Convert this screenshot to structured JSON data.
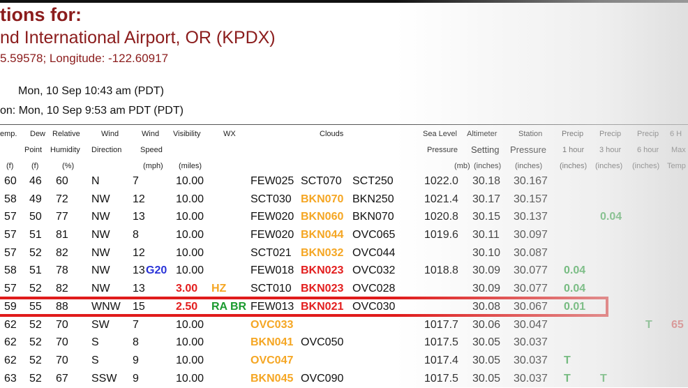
{
  "page": {
    "title": "tions for:",
    "subtitle": "nd International Airport, OR (KPDX)",
    "coords": "5.59578; Longitude: -122.60917",
    "obs_time": "Mon, 10 Sep 10:43 am (PDT)",
    "obs_time2": "on: Mon, 10 Sep 9:53 am PDT (PDT)"
  },
  "headers": {
    "temp": "emp.",
    "dew1": "Dew",
    "dew2": "Point",
    "rel1": "Relative",
    "rel2": "Humidity",
    "wind1": "Wind",
    "wind2": "Direction",
    "wspd1": "Wind",
    "wspd2": "Speed",
    "vis": "Visibility",
    "wx": "WX",
    "clouds": "Clouds",
    "slp1": "Sea Level",
    "slp2": "Pressure",
    "alt1": "Altimeter",
    "alt2": "Setting",
    "stn1": "Station",
    "stn2": "Pressure",
    "p1a": "Precip",
    "p1b": "1 hour",
    "p3a": "Precip",
    "p3b": "3 hour",
    "p6a": "Precip",
    "p6b": "6 hour",
    "max1": "6 H",
    "max2": "Max",
    "u_f1": "(f)",
    "u_f2": "(f)",
    "u_pct": "(%)",
    "u_mph": "(mph)",
    "u_miles": "(miles)",
    "u_mb": "(mb)",
    "u_in1": "(inches)",
    "u_in2": "(inches)",
    "u_in3": "(inches)",
    "u_in4": "(inches)",
    "u_in5": "(inches)",
    "u_temp": "Temp"
  },
  "rows": [
    {
      "t": "60",
      "d": "46",
      "h": "60",
      "dir": "N",
      "spd": "7",
      "gust": "",
      "vis": "10.00",
      "wx": "",
      "c1": "FEW025",
      "c2": "SCT070",
      "c3": "SCT250",
      "slp": "1022.0",
      "alt": "30.18",
      "stn": "30.167",
      "p1": "",
      "p3": "",
      "p6": "",
      "mx": ""
    },
    {
      "t": "58",
      "d": "49",
      "h": "72",
      "dir": "NW",
      "spd": "12",
      "gust": "",
      "vis": "10.00",
      "wx": "",
      "c1": "SCT030",
      "c2": "BKN070",
      "c3": "BKN250",
      "slp": "1021.4",
      "alt": "30.17",
      "stn": "30.157",
      "p1": "",
      "p3": "",
      "p6": "",
      "mx": ""
    },
    {
      "t": "57",
      "d": "50",
      "h": "77",
      "dir": "NW",
      "spd": "13",
      "gust": "",
      "vis": "10.00",
      "wx": "",
      "c1": "FEW020",
      "c2": "BKN060",
      "c3": "BKN070",
      "slp": "1020.8",
      "alt": "30.15",
      "stn": "30.137",
      "p1": "",
      "p3": "0.04",
      "p6": "",
      "mx": ""
    },
    {
      "t": "57",
      "d": "51",
      "h": "81",
      "dir": "NW",
      "spd": "8",
      "gust": "",
      "vis": "10.00",
      "wx": "",
      "c1": "FEW020",
      "c2": "BKN044",
      "c3": "OVC065",
      "slp": "1019.6",
      "alt": "30.11",
      "stn": "30.097",
      "p1": "",
      "p3": "",
      "p6": "",
      "mx": ""
    },
    {
      "t": "57",
      "d": "52",
      "h": "82",
      "dir": "NW",
      "spd": "12",
      "gust": "",
      "vis": "10.00",
      "wx": "",
      "c1": "SCT021",
      "c2": "BKN032",
      "c3": "OVC044",
      "slp": "",
      "alt": "30.10",
      "stn": "30.087",
      "p1": "",
      "p3": "",
      "p6": "",
      "mx": ""
    },
    {
      "t": "58",
      "d": "51",
      "h": "78",
      "dir": "NW",
      "spd": "13",
      "gust": "G20",
      "vis": "10.00",
      "wx": "",
      "c1": "FEW018",
      "c2": "BKN023",
      "c3": "OVC032",
      "slp": "1018.8",
      "alt": "30.09",
      "stn": "30.077",
      "p1": "0.04",
      "p3": "",
      "p6": "",
      "mx": ""
    },
    {
      "t": "57",
      "d": "52",
      "h": "82",
      "dir": "NW",
      "spd": "13",
      "gust": "",
      "vis": "3.00",
      "wx": "HZ",
      "c1": "SCT010",
      "c2": "BKN023",
      "c3": "OVC028",
      "slp": "",
      "alt": "30.09",
      "stn": "30.077",
      "p1": "0.04",
      "p3": "",
      "p6": "",
      "mx": ""
    },
    {
      "t": "59",
      "d": "55",
      "h": "88",
      "dir": "WNW",
      "spd": "15",
      "gust": "",
      "vis": "2.50",
      "wx": "RA BR",
      "c1": "FEW013",
      "c2": "BKN021",
      "c3": "OVC030",
      "slp": "",
      "alt": "30.08",
      "stn": "30.067",
      "p1": "0.01",
      "p3": "",
      "p6": "",
      "mx": ""
    },
    {
      "t": "62",
      "d": "52",
      "h": "70",
      "dir": "SW",
      "spd": "7",
      "gust": "",
      "vis": "10.00",
      "wx": "",
      "c1": "OVC033",
      "c2": "",
      "c3": "",
      "slp": "1017.7",
      "alt": "30.06",
      "stn": "30.047",
      "p1": "",
      "p3": "",
      "p6": "T",
      "mx": "65"
    },
    {
      "t": "62",
      "d": "52",
      "h": "70",
      "dir": "S",
      "spd": "8",
      "gust": "",
      "vis": "10.00",
      "wx": "",
      "c1": "BKN041",
      "c2": "OVC050",
      "c3": "",
      "slp": "1017.5",
      "alt": "30.05",
      "stn": "30.037",
      "p1": "",
      "p3": "",
      "p6": "",
      "mx": ""
    },
    {
      "t": "62",
      "d": "52",
      "h": "70",
      "dir": "S",
      "spd": "9",
      "gust": "",
      "vis": "10.00",
      "wx": "",
      "c1": "OVC047",
      "c2": "",
      "c3": "",
      "slp": "1017.4",
      "alt": "30.05",
      "stn": "30.037",
      "p1": "T",
      "p3": "",
      "p6": "",
      "mx": ""
    },
    {
      "t": "63",
      "d": "52",
      "h": "67",
      "dir": "SSW",
      "spd": "9",
      "gust": "",
      "vis": "10.00",
      "wx": "",
      "c1": "BKN045",
      "c2": "OVC090",
      "c3": "",
      "slp": "1017.5",
      "alt": "30.05",
      "stn": "30.037",
      "p1": "T",
      "p3": "T",
      "p6": "",
      "mx": ""
    }
  ],
  "colors": {
    "title": "#8b1c1c",
    "orange": "#f5a623",
    "red": "#e31e1e",
    "green": "#1a9a2e",
    "blue": "#2a34d8",
    "highlight": "#e01b1b"
  }
}
